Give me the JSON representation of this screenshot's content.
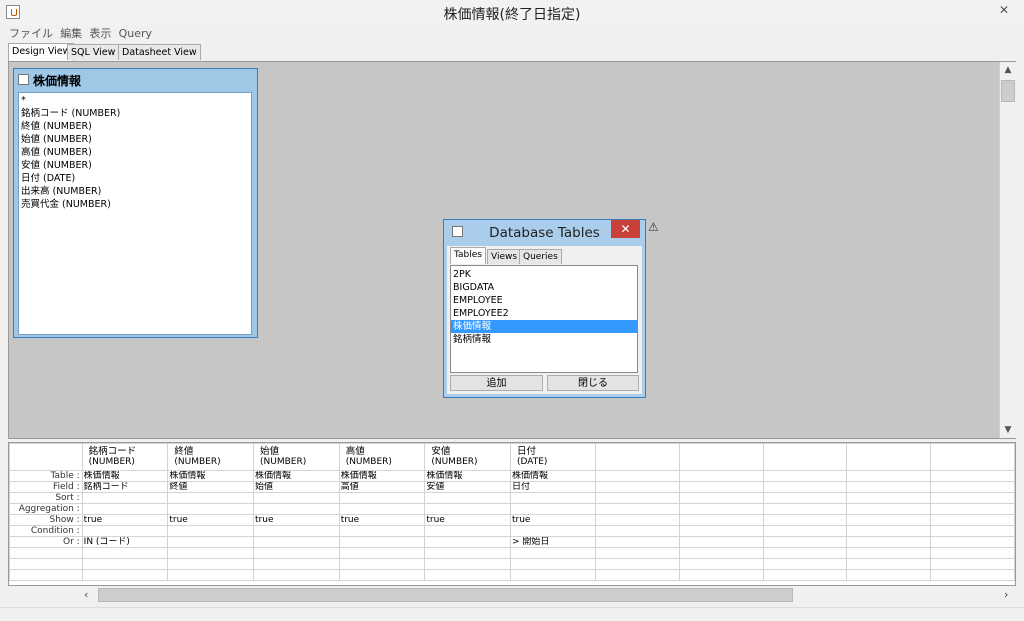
{
  "window": {
    "title": "株価情報(終了日指定)",
    "close_symbol": "✕"
  },
  "menu": [
    "ファイル",
    "編集",
    "表示",
    "Query"
  ],
  "view_tabs": [
    "Design View",
    "SQL View",
    "Datasheet View"
  ],
  "table_box": {
    "title": "株価情報",
    "fields": [
      "*",
      "銘柄コード (NUMBER)",
      "終値 (NUMBER)",
      "始値 (NUMBER)",
      "高値 (NUMBER)",
      "安値 (NUMBER)",
      "日付 (DATE)",
      "出来高 (NUMBER)",
      "売買代金 (NUMBER)"
    ]
  },
  "dialog": {
    "title": "Database Tables",
    "close_symbol": "✕",
    "tabs": [
      "Tables",
      "Views",
      "Queries"
    ],
    "items": [
      "2PK",
      "BIGDATA",
      "EMPLOYEE",
      "EMPLOYEE2",
      "株価情報",
      "銘柄情報"
    ],
    "selected_index": 4,
    "add_label": "追加",
    "close_label": "閉じる"
  },
  "grid": {
    "row_labels": [
      "Table :",
      "Field :",
      "Sort :",
      "Aggregation :",
      "Show :",
      "Condition :",
      "Or :"
    ],
    "columns": [
      {
        "name": "銘柄コード",
        "type": "(NUMBER)",
        "table": "株価情報",
        "field": "銘柄コード",
        "show": "true",
        "or": "IN (コード)"
      },
      {
        "name": "終値",
        "type": "(NUMBER)",
        "table": "株価情報",
        "field": "終値",
        "show": "true",
        "or": ""
      },
      {
        "name": "始値",
        "type": "(NUMBER)",
        "table": "株価情報",
        "field": "始値",
        "show": "true",
        "or": ""
      },
      {
        "name": "高値",
        "type": "(NUMBER)",
        "table": "株価情報",
        "field": "高値",
        "show": "true",
        "or": ""
      },
      {
        "name": "安値",
        "type": "(NUMBER)",
        "table": "株価情報",
        "field": "安値",
        "show": "true",
        "or": ""
      },
      {
        "name": "日付",
        "type": "(DATE)",
        "table": "株価情報",
        "field": "日付",
        "show": "true",
        "or": "> 開始日"
      }
    ],
    "empty_columns": 5
  },
  "icons": {
    "app": "java-cup-icon",
    "warning": "warning-icon"
  }
}
